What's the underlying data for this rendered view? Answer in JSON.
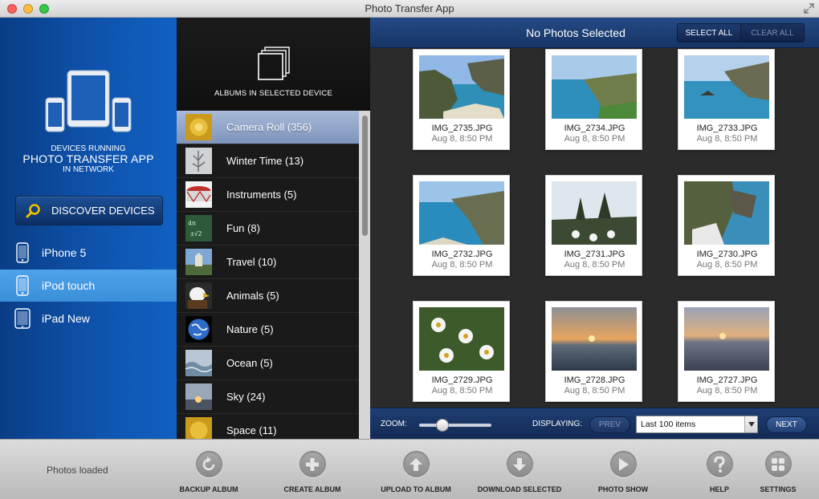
{
  "window": {
    "title": "Photo Transfer App"
  },
  "devices": {
    "caption": {
      "line1": "DEVICES RUNNING",
      "line2": "PHOTO TRANSFER APP",
      "line3": "IN NETWORK"
    },
    "discover_label": "DISCOVER DEVICES",
    "items": [
      {
        "label": "iPhone 5",
        "icon": "iphone-icon",
        "selected": false
      },
      {
        "label": "iPod touch",
        "icon": "ipod-icon",
        "selected": true
      },
      {
        "label": "iPad New",
        "icon": "ipad-icon",
        "selected": false
      }
    ]
  },
  "albums": {
    "header": "ALBUMS IN SELECTED DEVICE",
    "items": [
      {
        "label": "Camera Roll (356)",
        "selected": true
      },
      {
        "label": "Winter Time (13)",
        "selected": false
      },
      {
        "label": "Instruments (5)",
        "selected": false
      },
      {
        "label": "Fun (8)",
        "selected": false
      },
      {
        "label": "Travel (10)",
        "selected": false
      },
      {
        "label": "Animals (5)",
        "selected": false
      },
      {
        "label": "Nature (5)",
        "selected": false
      },
      {
        "label": "Ocean (5)",
        "selected": false
      },
      {
        "label": "Sky (24)",
        "selected": false
      },
      {
        "label": "Space (11)",
        "selected": false
      }
    ]
  },
  "photos": {
    "status": "No Photos Selected",
    "select_all": "SELECT ALL",
    "clear_all": "CLEAR ALL",
    "items": [
      {
        "name": "IMG_2735.JPG",
        "date": "Aug 8, 8:50 PM"
      },
      {
        "name": "IMG_2734.JPG",
        "date": "Aug 8, 8:50 PM"
      },
      {
        "name": "IMG_2733.JPG",
        "date": "Aug 8, 8:50 PM"
      },
      {
        "name": "IMG_2732.JPG",
        "date": "Aug 8, 8:50 PM"
      },
      {
        "name": "IMG_2731.JPG",
        "date": "Aug 8, 8:50 PM"
      },
      {
        "name": "IMG_2730.JPG",
        "date": "Aug 8, 8:50 PM"
      },
      {
        "name": "IMG_2729.JPG",
        "date": "Aug 8, 8:50 PM"
      },
      {
        "name": "IMG_2728.JPG",
        "date": "Aug 8, 8:50 PM"
      },
      {
        "name": "IMG_2727.JPG",
        "date": "Aug 8, 8:50 PM"
      }
    ],
    "footer": {
      "zoom_label": "ZOOM:",
      "zoom_level": 0.28,
      "displaying_label": "DISPLAYING:",
      "prev_label": "PREV",
      "range_value": "Last 100 items",
      "next_label": "NEXT"
    }
  },
  "toolbar": {
    "status": "Photos loaded",
    "buttons": [
      {
        "label": "BACKUP ALBUM",
        "icon": "backup-icon"
      },
      {
        "label": "CREATE ALBUM",
        "icon": "plus-icon"
      },
      {
        "label": "UPLOAD TO ALBUM",
        "icon": "upload-icon"
      },
      {
        "label": "DOWNLOAD SELECTED",
        "icon": "download-icon"
      },
      {
        "label": "PHOTO SHOW",
        "icon": "play-icon"
      },
      {
        "label": "HELP",
        "icon": "help-icon"
      },
      {
        "label": "SETTINGS",
        "icon": "settings-icon"
      }
    ]
  },
  "colors": {
    "device_panel": "#0f55b0",
    "selected_device": "#4fa3ea",
    "selected_album": "#a8b9d8",
    "header_blue": "#244a86",
    "light_close": "#fc605c",
    "light_min": "#fdbc40",
    "light_max": "#34c84a"
  }
}
